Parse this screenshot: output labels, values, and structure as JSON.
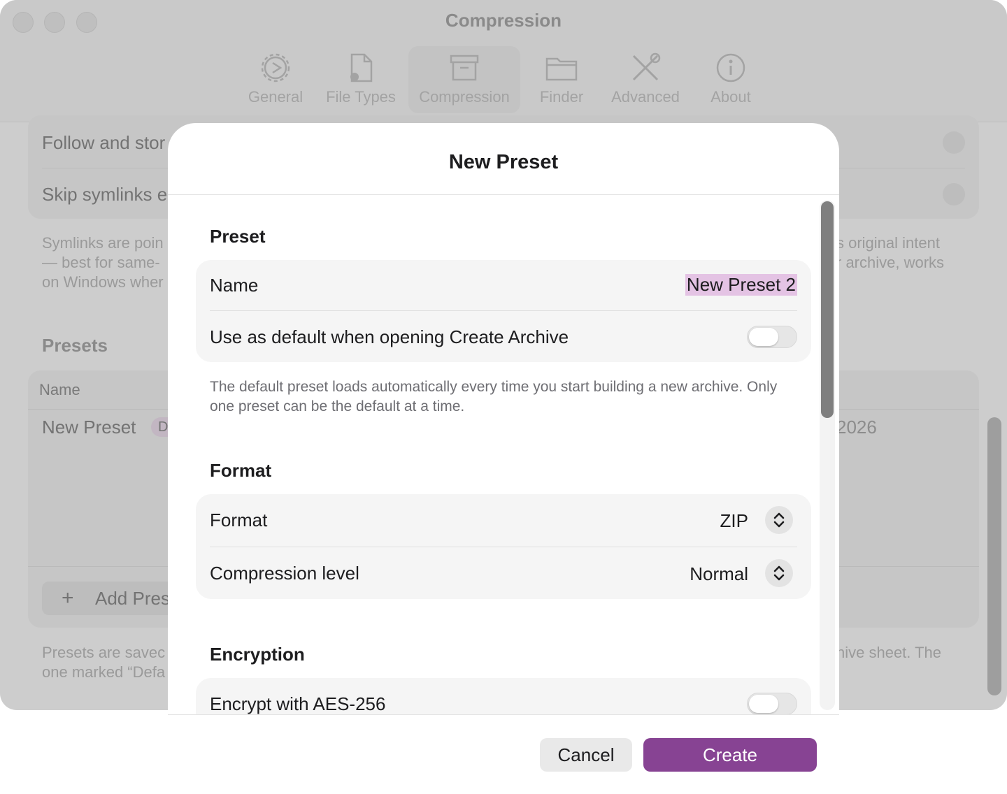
{
  "window": {
    "title": "Compression",
    "toolbar": [
      {
        "label": "General",
        "icon": "gear-icon"
      },
      {
        "label": "File Types",
        "icon": "document-gear-icon"
      },
      {
        "label": "Compression",
        "icon": "archive-box-icon",
        "active": true
      },
      {
        "label": "Finder",
        "icon": "folder-icon"
      },
      {
        "label": "Advanced",
        "icon": "tools-icon"
      },
      {
        "label": "About",
        "icon": "info-icon"
      }
    ]
  },
  "background": {
    "rows": [
      "Follow and stor",
      "Skip symlinks e"
    ],
    "symlink_note_left": [
      "Symlinks are poin",
      "— best for same-",
      "on Windows wher"
    ],
    "symlink_note_right": [
      "s original intent",
      "r archive, works"
    ],
    "presets_heading": "Presets",
    "table_header_name": "Name",
    "table_row_name": "New Preset",
    "table_row_badge": "D",
    "table_row_date": "2026",
    "add_preset_label": "Add Pres",
    "footer_left": [
      "Presets are savec",
      "one marked “Defa"
    ],
    "footer_right": "hive sheet. The"
  },
  "sheet": {
    "title": "New Preset",
    "preset_section": {
      "heading": "Preset",
      "name_label": "Name",
      "name_value": "New Preset 2",
      "default_label": "Use as default when opening Create Archive",
      "default_on": false,
      "footnote": "The default preset loads automatically every time you start building a new archive. Only one preset can be the default at a time."
    },
    "format_section": {
      "heading": "Format",
      "format_label": "Format",
      "format_value": "ZIP",
      "level_label": "Compression level",
      "level_value": "Normal"
    },
    "encryption_section": {
      "heading": "Encryption",
      "encrypt_label": "Encrypt with AES-256",
      "encrypt_on": false
    },
    "buttons": {
      "cancel": "Cancel",
      "create": "Create"
    },
    "accent_color": "#874393"
  }
}
